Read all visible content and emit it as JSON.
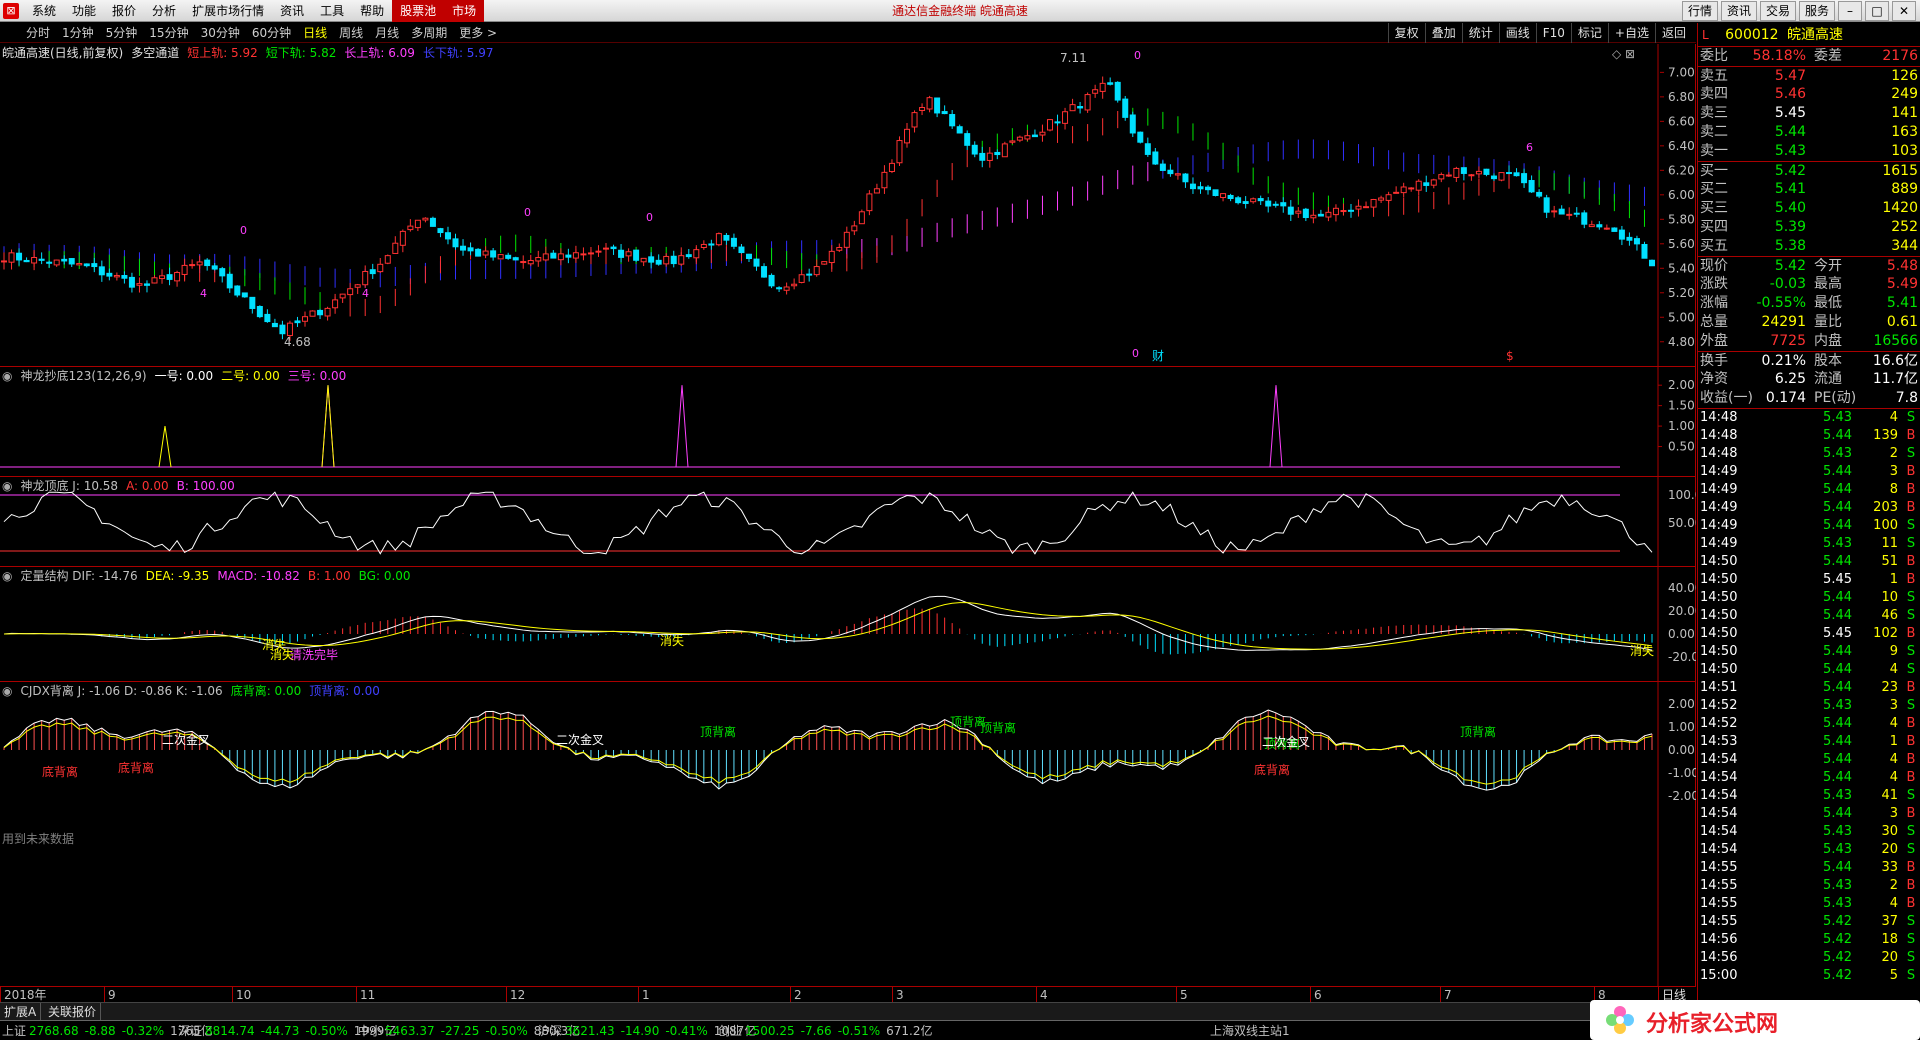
{
  "menu": {
    "items": [
      "系统",
      "功能",
      "报价",
      "分析",
      "扩展市场行情",
      "资讯",
      "工具",
      "帮助",
      "股票池",
      "市场"
    ],
    "highlight_indices": [
      8,
      9
    ],
    "title": "通达信金融终端  皖通高速",
    "buttons": [
      "行情",
      "资讯",
      "交易",
      "服务"
    ]
  },
  "periods": {
    "tabs": [
      "分时",
      "1分钟",
      "5分钟",
      "15分钟",
      "30分钟",
      "60分钟",
      "日线",
      "周线",
      "月线",
      "多周期",
      "更多 >"
    ],
    "active": "日线",
    "tools": [
      "复权",
      "叠加",
      "统计",
      "画线",
      "F10",
      "标记",
      "+自选",
      "返回"
    ]
  },
  "main_chart": {
    "header": {
      "stock": "皖通高速(日线,前复权)",
      "indicator": "多空通道",
      "items": [
        {
          "label": "短上轨: 5.92",
          "color": "#ff3232"
        },
        {
          "label": "短下轨: 5.82",
          "color": "#00e600"
        },
        {
          "label": "长上轨: 6.09",
          "color": "#ff40ff"
        },
        {
          "label": "长下轨: 5.97",
          "color": "#4040ff"
        }
      ]
    },
    "y_labels": [
      "7.00",
      "6.80",
      "6.60",
      "6.40",
      "6.20",
      "6.00",
      "5.80",
      "5.60",
      "5.40",
      "5.20",
      "5.00",
      "4.80"
    ],
    "ylim": [
      4.7,
      7.15
    ],
    "high_label": "7.11",
    "low_label": "4.68",
    "marks": [
      "0",
      "4",
      "4",
      "0",
      "0",
      "0",
      "6",
      "0"
    ],
    "bottom_marks": [
      "财",
      "$"
    ]
  },
  "pane2": {
    "header": [
      {
        "label": "神龙抄底123(12,26,9)",
        "color": "#c0c0c0"
      },
      {
        "label": "一号: 0.00",
        "color": "#ffffff"
      },
      {
        "label": "二号: 0.00",
        "color": "#ffff00"
      },
      {
        "label": "三号: 0.00",
        "color": "#ff40ff"
      }
    ],
    "y_labels": [
      "2.00",
      "1.50",
      "1.00",
      "0.50"
    ]
  },
  "pane3": {
    "header": [
      {
        "label": "神龙顶底  J: 10.58",
        "color": "#c0c0c0"
      },
      {
        "label": "A: 0.00",
        "color": "#ff3232"
      },
      {
        "label": "B: 100.00",
        "color": "#ff40ff"
      }
    ],
    "y_labels": [
      "100.0",
      "50.00"
    ]
  },
  "pane4": {
    "header": [
      {
        "label": "定量结构  DIF: -14.76",
        "color": "#c0c0c0"
      },
      {
        "label": "DEA: -9.35",
        "color": "#ffff00"
      },
      {
        "label": "MACD: -10.82",
        "color": "#ff40ff"
      },
      {
        "label": "B: 1.00",
        "color": "#ff3232"
      },
      {
        "label": "BG: 0.00",
        "color": "#00e600"
      }
    ],
    "y_labels": [
      "40.00",
      "20.00",
      "0.00",
      "-20.00"
    ],
    "annotations": [
      "消失",
      "消失",
      "消失",
      "消失",
      "清洗完毕"
    ]
  },
  "pane5": {
    "header": [
      {
        "label": "CJDX背离  J: -1.06  D: -0.86  K: -1.06",
        "color": "#c0c0c0"
      },
      {
        "label": "底背离: 0.00",
        "color": "#00e600"
      },
      {
        "label": "顶背离: 0.00",
        "color": "#4040ff"
      }
    ],
    "y_labels": [
      "2.00",
      "1.00",
      "0.00",
      "-1.00",
      "-2.00"
    ],
    "annotations": [
      "底背离",
      "底背离",
      "二次金叉",
      "二次金叉",
      "顶背离",
      "顶背离",
      "顶背离",
      "顶背离",
      "底背离",
      "二次金叉",
      "顶背离"
    ],
    "future_note": "用到未来数据"
  },
  "date_axis": {
    "labels": [
      "2018年",
      "9",
      "10",
      "11",
      "12",
      "1",
      "2",
      "3",
      "4",
      "5",
      "6",
      "7",
      "8"
    ],
    "right_label": "日线"
  },
  "bottom_tabs": [
    "扩展A",
    "关联报价"
  ],
  "quote": {
    "flag": "L",
    "code": "600012",
    "name": "皖通高速",
    "weibi": {
      "k": "委比",
      "v": "58.18%",
      "k2": "委差",
      "v2": "2176"
    },
    "asks": [
      {
        "k": "卖五",
        "p": "5.47",
        "v": "126",
        "c": "red"
      },
      {
        "k": "卖四",
        "p": "5.46",
        "v": "249",
        "c": "red"
      },
      {
        "k": "卖三",
        "p": "5.45",
        "v": "141",
        "c": "white"
      },
      {
        "k": "卖二",
        "p": "5.44",
        "v": "163",
        "c": "green"
      },
      {
        "k": "卖一",
        "p": "5.43",
        "v": "103",
        "c": "green"
      }
    ],
    "bids": [
      {
        "k": "买一",
        "p": "5.42",
        "v": "1615",
        "c": "green"
      },
      {
        "k": "买二",
        "p": "5.41",
        "v": "889",
        "c": "green"
      },
      {
        "k": "买三",
        "p": "5.40",
        "v": "1420",
        "c": "green"
      },
      {
        "k": "买四",
        "p": "5.39",
        "v": "252",
        "c": "green"
      },
      {
        "k": "买五",
        "p": "5.38",
        "v": "344",
        "c": "green"
      }
    ],
    "stats": [
      {
        "k": "现价",
        "v": "5.42",
        "vc": "green",
        "k2": "今开",
        "v2": "5.48",
        "v2c": "red"
      },
      {
        "k": "涨跌",
        "v": "-0.03",
        "vc": "green",
        "k2": "最高",
        "v2": "5.49",
        "v2c": "red"
      },
      {
        "k": "涨幅",
        "v": "-0.55%",
        "vc": "green",
        "k2": "最低",
        "v2": "5.41",
        "v2c": "green"
      },
      {
        "k": "总量",
        "v": "24291",
        "vc": "yellow",
        "k2": "量比",
        "v2": "0.61",
        "v2c": "yellow"
      },
      {
        "k": "外盘",
        "v": "7725",
        "vc": "red",
        "k2": "内盘",
        "v2": "16566",
        "v2c": "green"
      }
    ],
    "stats2": [
      {
        "k": "换手",
        "v": "0.21%",
        "vc": "white",
        "k2": "股本",
        "v2": "16.6亿",
        "v2c": "white"
      },
      {
        "k": "净资",
        "v": "6.25",
        "vc": "white",
        "k2": "流通",
        "v2": "11.7亿",
        "v2c": "white"
      },
      {
        "k": "收益(一)",
        "v": "0.174",
        "vc": "white",
        "k2": "PE(动)",
        "v2": "7.8",
        "v2c": "white"
      }
    ],
    "ticks": [
      {
        "t": "14:48",
        "p": "5.43",
        "pc": "green",
        "v": "4",
        "bs": "S"
      },
      {
        "t": "14:48",
        "p": "5.44",
        "pc": "green",
        "v": "139",
        "bs": "B"
      },
      {
        "t": "14:48",
        "p": "5.43",
        "pc": "green",
        "v": "2",
        "bs": "S"
      },
      {
        "t": "14:49",
        "p": "5.44",
        "pc": "green",
        "v": "3",
        "bs": "B"
      },
      {
        "t": "14:49",
        "p": "5.44",
        "pc": "green",
        "v": "8",
        "bs": "B"
      },
      {
        "t": "14:49",
        "p": "5.44",
        "pc": "green",
        "v": "203",
        "bs": "B"
      },
      {
        "t": "14:49",
        "p": "5.44",
        "pc": "green",
        "v": "100",
        "bs": "S"
      },
      {
        "t": "14:49",
        "p": "5.43",
        "pc": "green",
        "v": "11",
        "bs": "S"
      },
      {
        "t": "14:50",
        "p": "5.44",
        "pc": "green",
        "v": "51",
        "bs": "B"
      },
      {
        "t": "14:50",
        "p": "5.45",
        "pc": "white",
        "v": "1",
        "bs": "B"
      },
      {
        "t": "14:50",
        "p": "5.44",
        "pc": "green",
        "v": "10",
        "bs": "S"
      },
      {
        "t": "14:50",
        "p": "5.44",
        "pc": "green",
        "v": "46",
        "bs": "S"
      },
      {
        "t": "14:50",
        "p": "5.45",
        "pc": "white",
        "v": "102",
        "bs": "B"
      },
      {
        "t": "14:50",
        "p": "5.44",
        "pc": "green",
        "v": "9",
        "bs": "S"
      },
      {
        "t": "14:50",
        "p": "5.44",
        "pc": "green",
        "v": "4",
        "bs": "S"
      },
      {
        "t": "14:51",
        "p": "5.44",
        "pc": "green",
        "v": "23",
        "bs": "B"
      },
      {
        "t": "14:52",
        "p": "5.43",
        "pc": "green",
        "v": "3",
        "bs": "S"
      },
      {
        "t": "14:52",
        "p": "5.44",
        "pc": "green",
        "v": "4",
        "bs": "B"
      },
      {
        "t": "14:53",
        "p": "5.44",
        "pc": "green",
        "v": "1",
        "bs": "B"
      },
      {
        "t": "14:54",
        "p": "5.44",
        "pc": "green",
        "v": "4",
        "bs": "B"
      },
      {
        "t": "14:54",
        "p": "5.44",
        "pc": "green",
        "v": "4",
        "bs": "B"
      },
      {
        "t": "14:54",
        "p": "5.43",
        "pc": "green",
        "v": "41",
        "bs": "S"
      },
      {
        "t": "14:54",
        "p": "5.44",
        "pc": "green",
        "v": "3",
        "bs": "B"
      },
      {
        "t": "14:54",
        "p": "5.43",
        "pc": "green",
        "v": "30",
        "bs": "S"
      },
      {
        "t": "14:54",
        "p": "5.43",
        "pc": "green",
        "v": "20",
        "bs": "S"
      },
      {
        "t": "14:55",
        "p": "5.44",
        "pc": "green",
        "v": "33",
        "bs": "B"
      },
      {
        "t": "14:55",
        "p": "5.43",
        "pc": "green",
        "v": "2",
        "bs": "B"
      },
      {
        "t": "14:55",
        "p": "5.43",
        "pc": "green",
        "v": "4",
        "bs": "B"
      },
      {
        "t": "14:55",
        "p": "5.42",
        "pc": "green",
        "v": "37",
        "bs": "S"
      },
      {
        "t": "14:56",
        "p": "5.42",
        "pc": "green",
        "v": "18",
        "bs": "S"
      },
      {
        "t": "14:56",
        "p": "5.42",
        "pc": "green",
        "v": "20",
        "bs": "S"
      },
      {
        "t": "15:00",
        "p": "5.42",
        "pc": "green",
        "v": "5",
        "bs": "S"
      }
    ]
  },
  "status": {
    "indices": [
      {
        "n": "上证",
        "v": "2768.68",
        "d": "-8.88",
        "p": "-0.32%",
        "a": "1765亿"
      },
      {
        "n": "深证",
        "v": "8814.74",
        "d": "-44.73",
        "p": "-0.50%",
        "a": "1999亿"
      },
      {
        "n": "中小",
        "v": "5463.37",
        "d": "-27.25",
        "p": "-0.50%",
        "a": "880.3亿"
      },
      {
        "n": "沪深",
        "v": "3621.43",
        "d": "-14.90",
        "p": "-0.41%",
        "a": "1087亿"
      },
      {
        "n": "创业",
        "v": "1500.25",
        "d": "-7.66",
        "p": "-0.51%",
        "a": "671.2亿"
      }
    ],
    "server": "上海双线主站1"
  },
  "logo": {
    "text": "分析家公式网"
  },
  "colors": {
    "up": "#ff3232",
    "down": "#00e0ff",
    "grid": "#a00000",
    "short_channel_up": "#ff3232",
    "short_channel_dn": "#00e600",
    "long_up": "#ff40ff",
    "long_dn": "#4040ff"
  }
}
